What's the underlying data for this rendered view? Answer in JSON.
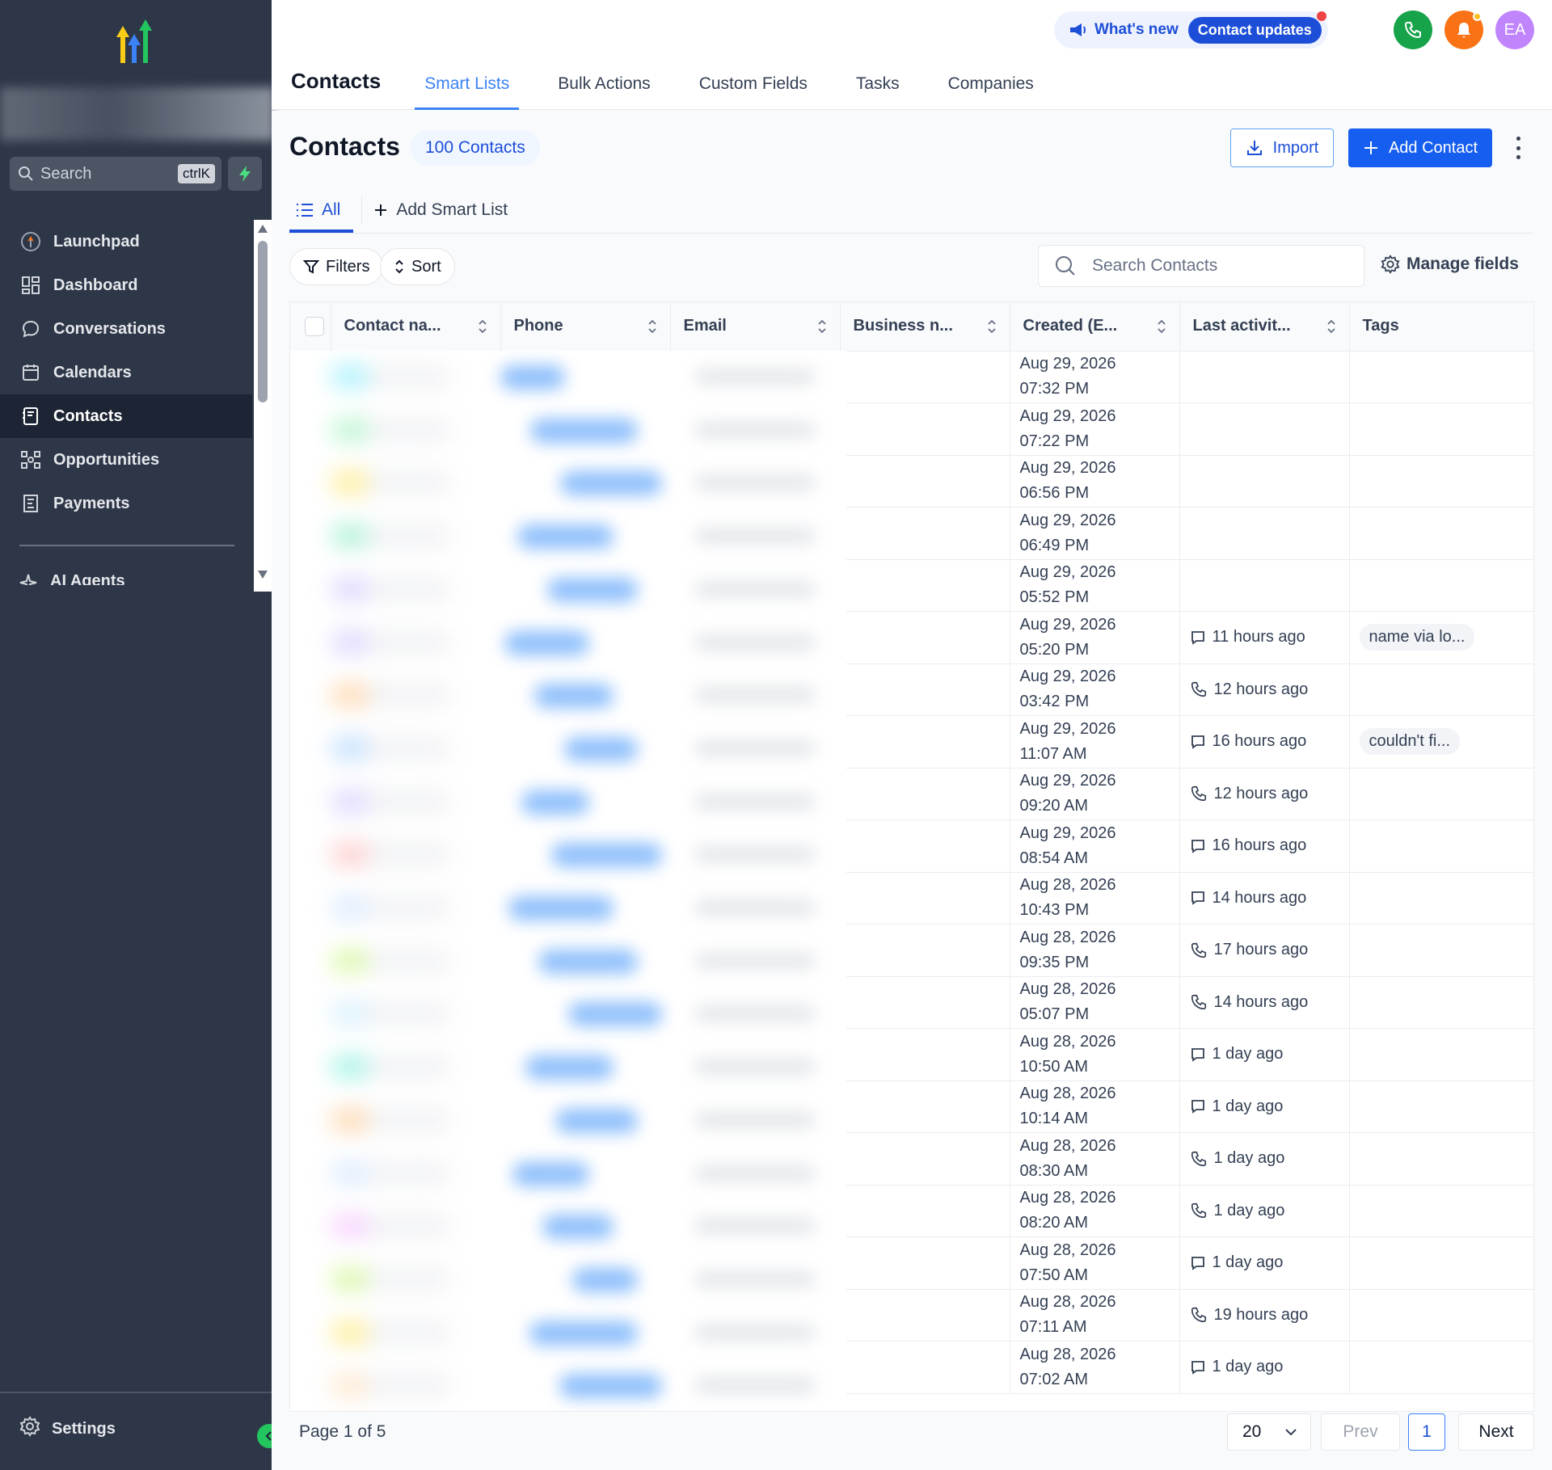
{
  "sidebar": {
    "search_placeholder": "Search",
    "search_shortcut": "ctrlK",
    "items": [
      {
        "label": "Launchpad",
        "icon": "rocket-icon"
      },
      {
        "label": "Dashboard",
        "icon": "grid-icon"
      },
      {
        "label": "Conversations",
        "icon": "chat-icon"
      },
      {
        "label": "Calendars",
        "icon": "calendar-icon"
      },
      {
        "label": "Contacts",
        "icon": "contacts-icon",
        "active": true
      },
      {
        "label": "Opportunities",
        "icon": "pipeline-icon"
      },
      {
        "label": "Payments",
        "icon": "receipt-icon"
      }
    ],
    "partial_item": "AI Agents",
    "settings_label": "Settings"
  },
  "topbar": {
    "whats_new_label": "What's new",
    "whats_new_pill": "Contact updates",
    "avatar_initials": "EA",
    "section_title": "Contacts",
    "tabs": [
      "Smart Lists",
      "Bulk Actions",
      "Custom Fields",
      "Tasks",
      "Companies"
    ],
    "active_tab": "Smart Lists"
  },
  "header": {
    "title": "Contacts",
    "count_badge": "100 Contacts",
    "import_label": "Import",
    "add_contact_label": "Add Contact"
  },
  "smart_lists": {
    "all_label": "All",
    "add_label": "Add Smart List"
  },
  "toolbar": {
    "filters_label": "Filters",
    "sort_label": "Sort",
    "search_placeholder": "Search Contacts",
    "manage_fields_label": "Manage fields"
  },
  "table": {
    "columns": [
      "Contact na...",
      "Phone",
      "Email",
      "Business n...",
      "Created (E...",
      "Last activit...",
      "Tags"
    ],
    "rows": [
      {
        "date": "Aug 29, 2026",
        "time": "07:32 PM",
        "activity": "",
        "activity_icon": "",
        "tag": ""
      },
      {
        "date": "Aug 29, 2026",
        "time": "07:22 PM",
        "activity": "",
        "activity_icon": "",
        "tag": ""
      },
      {
        "date": "Aug 29, 2026",
        "time": "06:56 PM",
        "activity": "",
        "activity_icon": "",
        "tag": ""
      },
      {
        "date": "Aug 29, 2026",
        "time": "06:49 PM",
        "activity": "",
        "activity_icon": "",
        "tag": ""
      },
      {
        "date": "Aug 29, 2026",
        "time": "05:52 PM",
        "activity": "",
        "activity_icon": "",
        "tag": ""
      },
      {
        "date": "Aug 29, 2026",
        "time": "05:20 PM",
        "activity": "11 hours ago",
        "activity_icon": "chat",
        "tag": "name via lo..."
      },
      {
        "date": "Aug 29, 2026",
        "time": "03:42 PM",
        "activity": "12 hours ago",
        "activity_icon": "phone",
        "tag": ""
      },
      {
        "date": "Aug 29, 2026",
        "time": "11:07 AM",
        "activity": "16 hours ago",
        "activity_icon": "chat",
        "tag": "couldn't fi..."
      },
      {
        "date": "Aug 29, 2026",
        "time": "09:20 AM",
        "activity": "12 hours ago",
        "activity_icon": "phone",
        "tag": ""
      },
      {
        "date": "Aug 29, 2026",
        "time": "08:54 AM",
        "activity": "16 hours ago",
        "activity_icon": "chat",
        "tag": ""
      },
      {
        "date": "Aug 28, 2026",
        "time": "10:43 PM",
        "activity": "14 hours ago",
        "activity_icon": "chat",
        "tag": ""
      },
      {
        "date": "Aug 28, 2026",
        "time": "09:35 PM",
        "activity": "17 hours ago",
        "activity_icon": "phone",
        "tag": ""
      },
      {
        "date": "Aug 28, 2026",
        "time": "05:07 PM",
        "activity": "14 hours ago",
        "activity_icon": "phone",
        "tag": ""
      },
      {
        "date": "Aug 28, 2026",
        "time": "10:50 AM",
        "activity": "1 day ago",
        "activity_icon": "chat",
        "tag": ""
      },
      {
        "date": "Aug 28, 2026",
        "time": "10:14 AM",
        "activity": "1 day ago",
        "activity_icon": "chat",
        "tag": ""
      },
      {
        "date": "Aug 28, 2026",
        "time": "08:30 AM",
        "activity": "1 day ago",
        "activity_icon": "phone",
        "tag": ""
      },
      {
        "date": "Aug 28, 2026",
        "time": "08:20 AM",
        "activity": "1 day ago",
        "activity_icon": "phone",
        "tag": ""
      },
      {
        "date": "Aug 28, 2026",
        "time": "07:50 AM",
        "activity": "1 day ago",
        "activity_icon": "chat",
        "tag": ""
      },
      {
        "date": "Aug 28, 2026",
        "time": "07:11 AM",
        "activity": "19 hours ago",
        "activity_icon": "phone",
        "tag": ""
      },
      {
        "date": "Aug 28, 2026",
        "time": "07:02 AM",
        "activity": "1 day ago",
        "activity_icon": "chat",
        "tag": ""
      }
    ]
  },
  "pagination": {
    "page_info": "Page 1 of 5",
    "page_size": "20",
    "prev_label": "Prev",
    "current_page": "1",
    "next_label": "Next"
  },
  "colors": {
    "sidebar_bg": "#2e3748",
    "primary": "#155eef",
    "accent_green": "#16a34a",
    "accent_orange": "#f97316",
    "avatar": "#c084fc"
  }
}
